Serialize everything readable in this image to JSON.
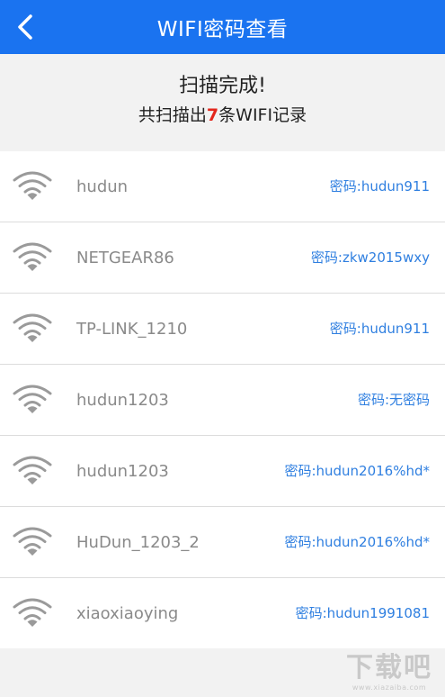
{
  "header": {
    "title": "WIFI密码查看",
    "back_icon": "chevron-left-icon",
    "background": "#1a73f0"
  },
  "summary": {
    "line1": "扫描完成!",
    "line2_prefix": "共扫描出",
    "count": "7",
    "line2_suffix": "条WIFI记录",
    "count_color": "#e3261c"
  },
  "records": [
    {
      "ssid": "hudun",
      "password_text": "密码:hudun911"
    },
    {
      "ssid": "NETGEAR86",
      "password_text": "密码:zkw2015wxy"
    },
    {
      "ssid": "TP-LINK_1210",
      "password_text": "密码:hudun911"
    },
    {
      "ssid": "hudun1203",
      "password_text": "密码:无密码"
    },
    {
      "ssid": "hudun1203",
      "password_text": "密码:hudun2016%hd*"
    },
    {
      "ssid": "HuDun_1203_2",
      "password_text": "密码:hudun2016%hd*"
    },
    {
      "ssid": "xiaoxiaoying",
      "password_text": "密码:hudun1991081"
    }
  ],
  "row_icon": "wifi-signal-icon",
  "watermark": {
    "logo": "下载吧",
    "url": "www.xiazaiba.com"
  }
}
